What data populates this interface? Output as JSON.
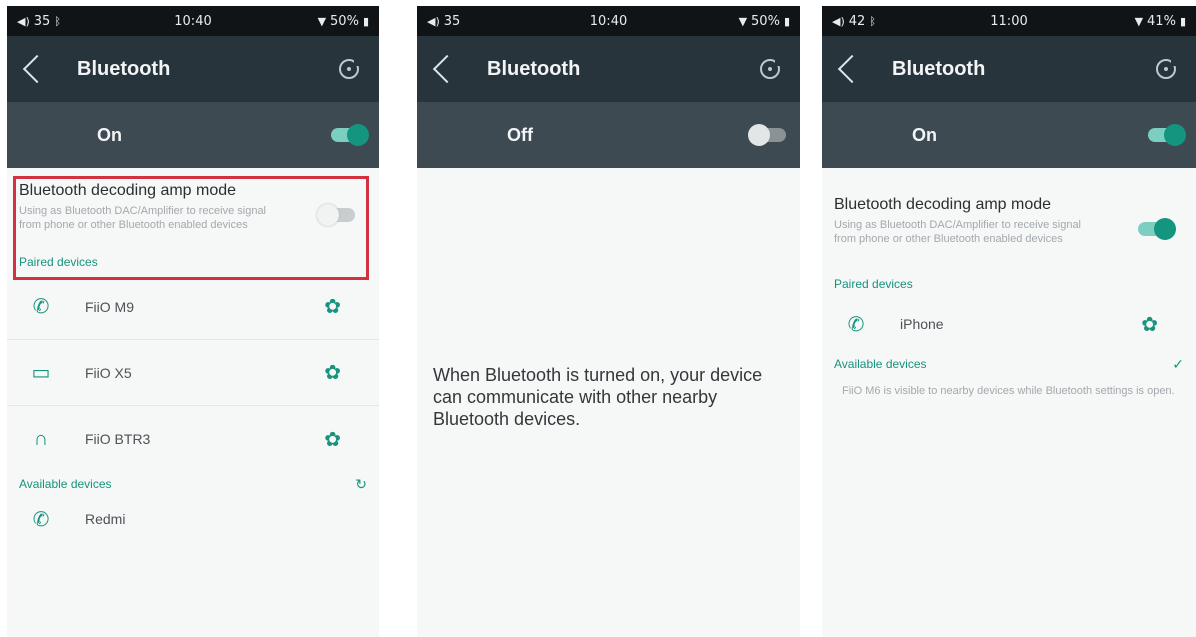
{
  "colors": {
    "accent": "#17937e",
    "appbar": "#28343c",
    "masterbar": "#3d4a52",
    "statusbar": "#101416",
    "highlight": "#d4313f"
  },
  "screens": [
    {
      "status": {
        "left": "35",
        "time": "10:40",
        "battery": "50%"
      },
      "title": "Bluetooth",
      "master": {
        "label": "On",
        "on": true
      },
      "amp": {
        "title": "Bluetooth decoding amp mode",
        "desc": "Using as Bluetooth DAC/Amplifier to receive signal from phone or other Bluetooth enabled devices",
        "on": false
      },
      "paired_header": "Paired devices",
      "paired": [
        {
          "name": "FiiO M9",
          "icon": "phone-icon"
        },
        {
          "name": "FiiO X5",
          "icon": "laptop-icon"
        },
        {
          "name": "FiiO BTR3",
          "icon": "headphones-icon"
        }
      ],
      "available_header": "Available devices",
      "available": [
        {
          "name": "Redmi",
          "icon": "phone-icon"
        }
      ]
    },
    {
      "status": {
        "left": "35",
        "time": "10:40",
        "battery": "50%"
      },
      "title": "Bluetooth",
      "master": {
        "label": "Off",
        "on": false
      },
      "info": "When Bluetooth is turned on, your device can communicate with other nearby Bluetooth devices."
    },
    {
      "status": {
        "left": "42",
        "time": "11:00",
        "battery": "41%"
      },
      "title": "Bluetooth",
      "master": {
        "label": "On",
        "on": true
      },
      "amp": {
        "title": "Bluetooth decoding amp mode",
        "desc": "Using as Bluetooth DAC/Amplifier to receive signal from phone or other Bluetooth enabled devices",
        "on": true
      },
      "paired_header": "Paired devices",
      "paired": [
        {
          "name": "iPhone",
          "icon": "phone-icon"
        }
      ],
      "available_header": "Available devices",
      "available_info": "FiiO M6 is visible to nearby devices while Bluetooth settings is open."
    }
  ]
}
